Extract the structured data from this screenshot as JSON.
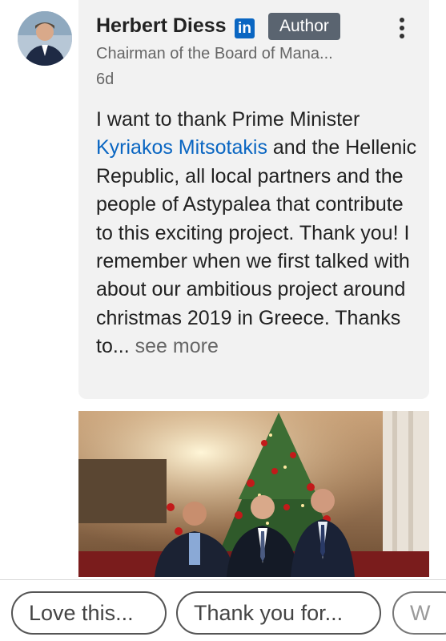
{
  "post": {
    "author_name": "Herbert Diess",
    "linkedin_badge": "in",
    "author_badge": "Author",
    "headline": "Chairman of the Board of Mana...",
    "time": "6d",
    "body_before_link": "I want to thank Prime Minister ",
    "mention": "Kyriakos Mitsotakis",
    "body_after_link": " and the Hellenic Republic, all local partners and the people of Astypalea that contribute to this exciting project. Thank you! I remember when we first talked with about our ambitious project around christmas 2019 in Greece. Thanks to",
    "ellipsis": "...",
    "see_more": " see more",
    "colors": {
      "link": "#0a66c2",
      "card_background": "#f2f2f2",
      "author_badge": "#5a6470"
    }
  },
  "media": {
    "icon": "photo-christmas-tree-three-men"
  },
  "suggestions": [
    "Love this...",
    "Thank you for...",
    "W"
  ],
  "icons": {
    "menu": "kebab-menu-icon",
    "linkedin": "linkedin-icon"
  }
}
